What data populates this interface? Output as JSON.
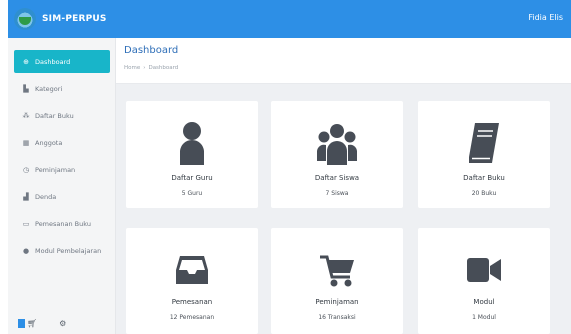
{
  "brand": {
    "name": "SIM-PERPUS"
  },
  "topbar": {
    "user": "Fidia Elis"
  },
  "header": {
    "title": "Dashboard",
    "breadcrumb": [
      "Home",
      "Dashboard"
    ]
  },
  "sidebar": {
    "items": [
      {
        "label": "Dashboard",
        "icon": "home-icon",
        "active": true
      },
      {
        "label": "Kategori",
        "icon": "book-icon",
        "active": false
      },
      {
        "label": "Daftar Buku",
        "icon": "list-icon",
        "active": false
      },
      {
        "label": "Anggota",
        "icon": "users-icon",
        "active": false
      },
      {
        "label": "Peminjaman",
        "icon": "clock-icon",
        "active": false
      },
      {
        "label": "Denda",
        "icon": "bar-chart-icon",
        "active": false
      },
      {
        "label": "Pemesanan Buku",
        "icon": "inbox-icon",
        "active": false
      },
      {
        "label": "Modul Pembelajaran",
        "icon": "info-icon",
        "active": false
      }
    ],
    "footer": {
      "cart_icon": "cart-icon",
      "settings_icon": "settings-icon"
    }
  },
  "cards": [
    {
      "label": "Daftar Guru",
      "count": "5 Guru",
      "icon": "user-icon"
    },
    {
      "label": "Daftar Siswa",
      "count": "7 Siswa",
      "icon": "users-icon"
    },
    {
      "label": "Daftar Buku",
      "count": "20 Buku",
      "icon": "book-icon"
    },
    {
      "label": "Pemesanan",
      "count": "12 Pemesanan",
      "icon": "inbox-icon"
    },
    {
      "label": "Peminjaman",
      "count": "16 Transaksi",
      "icon": "cart-icon"
    },
    {
      "label": "Modul",
      "count": "1 Modul",
      "icon": "video-camera-icon"
    }
  ],
  "colors": {
    "primary": "#2d8fe6",
    "active": "#18b5c9",
    "background": "#eef0f3"
  }
}
